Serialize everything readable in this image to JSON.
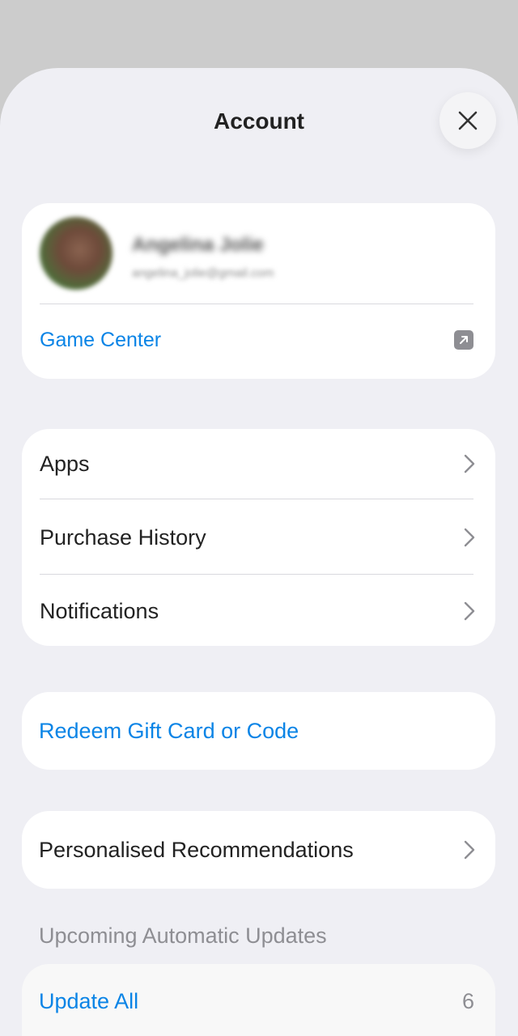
{
  "sheet": {
    "title": "Account",
    "close_icon": "close-icon"
  },
  "profile": {
    "name": "Angelina Jolie",
    "email": "angelina_jolie@gmail.com",
    "game_center_label": "Game Center",
    "game_center_icon": "external-link-icon"
  },
  "menu": {
    "items": [
      {
        "label": "Apps"
      },
      {
        "label": "Purchase History"
      },
      {
        "label": "Notifications"
      }
    ]
  },
  "redeem": {
    "label": "Redeem Gift Card or Code"
  },
  "recommendations": {
    "label": "Personalised Recommendations"
  },
  "updates": {
    "section_label": "Upcoming Automatic Updates",
    "update_all_label": "Update All",
    "count": "6"
  },
  "colors": {
    "accent": "#0a84e6",
    "background": "#efeff4",
    "card": "#ffffff",
    "secondary_text": "#8e8e93"
  }
}
